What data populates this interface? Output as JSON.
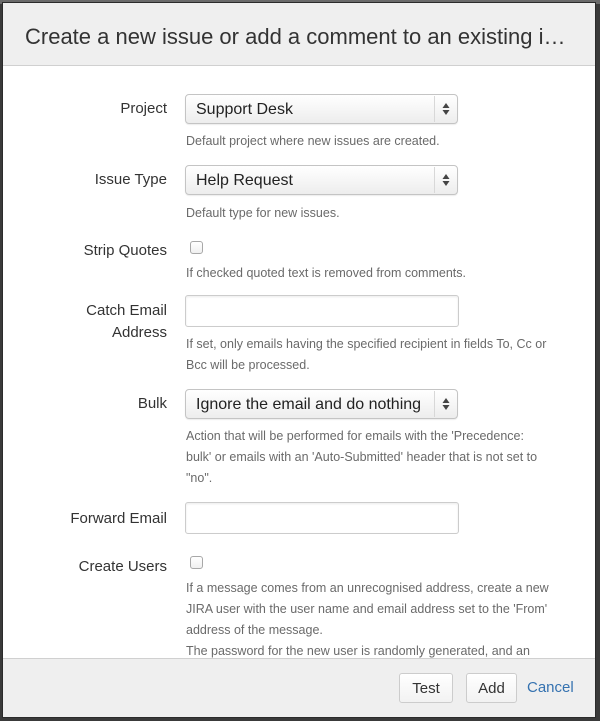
{
  "dialog": {
    "title": "Create a new issue or add a comment to an existing i…"
  },
  "form": {
    "project": {
      "label": "Project",
      "value": "Support Desk",
      "description": "Default project where new issues are created."
    },
    "issue_type": {
      "label": "Issue Type",
      "value": "Help Request",
      "description": "Default type for new issues."
    },
    "strip_quotes": {
      "label": "Strip Quotes",
      "checked": false,
      "description": "If checked quoted text is removed from comments."
    },
    "catch_email": {
      "label_line1": "Catch Email",
      "label_line2": "Address",
      "value": "",
      "description_line1": "If set, only emails having the specified recipient in fields To, Cc or",
      "description_line2": "Bcc will be processed."
    },
    "bulk": {
      "label": "Bulk",
      "value": "Ignore the email and do nothing",
      "description_line1": "Action that will be performed for emails with the 'Precedence:",
      "description_line2": "bulk' or emails with an 'Auto-Submitted' header that is not set to",
      "description_line3": "\"no\"."
    },
    "forward_email": {
      "label": "Forward Email",
      "value": ""
    },
    "create_users": {
      "label": "Create Users",
      "checked": false,
      "description_line1": "If a message comes from an unrecognised address, create a new",
      "description_line2": "JIRA user with the user name and email address set to the 'From'",
      "description_line3": "address of the message.",
      "description_line4": "The password for the new user is randomly generated, and an"
    }
  },
  "footer": {
    "test_label": "Test",
    "add_label": "Add",
    "cancel_label": "Cancel"
  },
  "icons": {
    "select_arrows": "up-down-chevron-icon"
  },
  "colors": {
    "link": "#3572b0",
    "header_bg": "#efefef",
    "description_text": "#6a6a6a"
  }
}
